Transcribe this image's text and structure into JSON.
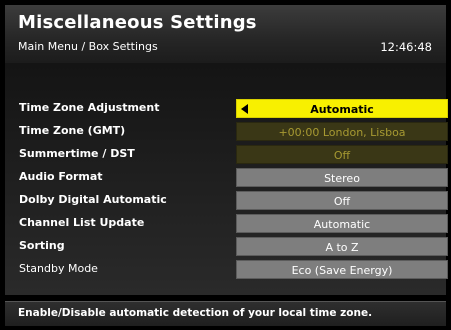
{
  "header": {
    "title": "Miscellaneous Settings",
    "breadcrumb": "Main Menu / Box Settings",
    "clock": "12:46:48"
  },
  "settings": [
    {
      "label": "Time Zone Adjustment",
      "value": "Automatic"
    },
    {
      "label": "Time Zone (GMT)",
      "value": "+00:00  London, Lisboa"
    },
    {
      "label": "Summertime / DST",
      "value": "Off"
    },
    {
      "label": "Audio Format",
      "value": "Stereo"
    },
    {
      "label": "Dolby Digital Automatic",
      "value": "Off"
    },
    {
      "label": "Channel List Update",
      "value": "Automatic"
    },
    {
      "label": "Sorting",
      "value": "A to Z"
    },
    {
      "label": "Standby Mode",
      "value": "Eco (Save Energy)"
    }
  ],
  "footer": {
    "help": "Enable/Disable automatic detection of your local time zone."
  },
  "colors": {
    "selected": "#f8f000",
    "dimmed": "#3a3716",
    "normal": "#7e7e7e"
  }
}
